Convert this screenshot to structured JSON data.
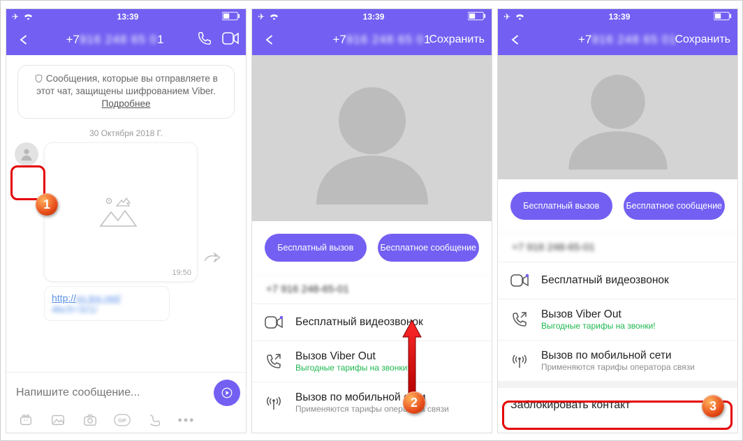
{
  "status": {
    "time": "13:39"
  },
  "phone1": {
    "header_title_prefix": "+7",
    "header_title_suffix": "1",
    "notice_line": "Сообщения, которые вы отправляете в этот чат, защищены шифрованием Viber. ",
    "notice_more": "Подробнее",
    "date": "30 Октября 2018 Г.",
    "msg_time": "19:50",
    "link_prefix": "http://",
    "composer_placeholder": "Напишите сообщение..."
  },
  "phone2": {
    "header_title_prefix": "+7",
    "header_title_suffix": "1",
    "save": "Сохранить",
    "btn_call": "Бесплатный вызов",
    "btn_msg": "Бесплатное сообщение",
    "phone_display_prefix": "+7",
    "phone_display_suffix": "1",
    "opt_video": "Бесплатный видеозвонок",
    "opt_viberout": "Вызов Viber Out",
    "opt_viberout_sub": "Выгодные тарифы на звонки!",
    "opt_mobile": "Вызов по мобильной сети",
    "opt_mobile_sub": "Применяются тарифы оператора связи"
  },
  "phone3": {
    "header_title_prefix": "+7",
    "save": "Сохранить",
    "btn_call": "Бесплатный вызов",
    "btn_msg": "Бесплатное сообщение",
    "opt_video": "Бесплатный видеозвонок",
    "opt_viberout": "Вызов Viber Out",
    "opt_viberout_sub": "Выгодные тарифы на звонки!",
    "opt_mobile": "Вызов по мобильной сети",
    "opt_mobile_sub": "Применяются тарифы оператора связи",
    "opt_block": "Заблокировать контакт"
  },
  "badges": {
    "b1": "1",
    "b2": "2",
    "b3": "3"
  }
}
